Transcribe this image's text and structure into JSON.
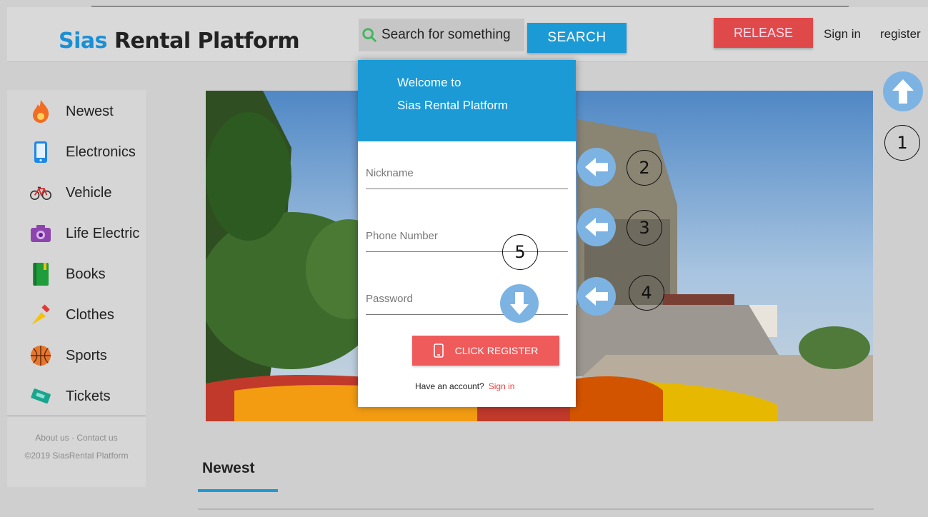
{
  "header": {
    "brand_accent": "Sias",
    "brand_rest": " Rental Platform",
    "search_placeholder": "Search for something",
    "search_button": "SEARCH",
    "release_button": "RELEASE",
    "sign_in": "Sign in",
    "register": "register"
  },
  "sidebar": {
    "items": [
      {
        "label": "Newest",
        "icon": "flame-icon"
      },
      {
        "label": "Electronics",
        "icon": "phone-icon"
      },
      {
        "label": "Vehicle",
        "icon": "bicycle-icon"
      },
      {
        "label": "Life Electric",
        "icon": "camera-icon"
      },
      {
        "label": "Books",
        "icon": "book-icon"
      },
      {
        "label": "Clothes",
        "icon": "brush-icon"
      },
      {
        "label": "Sports",
        "icon": "basketball-icon"
      },
      {
        "label": "Tickets",
        "icon": "ticket-icon"
      }
    ],
    "footer_links": "About us · Contact us",
    "footer_copyright": "©2019 SiasRental Platform"
  },
  "modal": {
    "welcome_line1": "Welcome to",
    "welcome_line2": "Sias Rental Platform",
    "nickname_placeholder": "Nickname",
    "phone_placeholder": "Phone Number",
    "password_placeholder": "Password",
    "register_button": "CLICK REGISTER",
    "have_account": "Have an account?",
    "sign_in_link": "Sign in"
  },
  "annotations": [
    "1",
    "2",
    "3",
    "4",
    "5"
  ],
  "section": {
    "title": "Newest"
  },
  "colors": {
    "accent_blue": "#1b9ad6",
    "release_red": "#e04949",
    "register_red": "#ef5a5a",
    "annotation_arrow": "#7db3e3"
  }
}
